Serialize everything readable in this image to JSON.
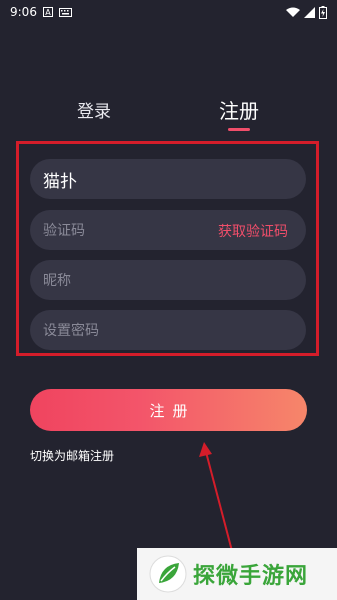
{
  "status_bar": {
    "time": "9:06",
    "left_icons": [
      "a-notification-icon",
      "keyboard-icon"
    ],
    "right_icons": [
      "wifi-icon",
      "signal-icon",
      "battery-icon"
    ]
  },
  "tabs": [
    {
      "label": "登录",
      "selected": false
    },
    {
      "label": "注册",
      "selected": true
    }
  ],
  "form": {
    "phone_value": "猫扑",
    "code_placeholder": "验证码",
    "get_code_label": "获取验证码",
    "nickname_placeholder": "昵称",
    "password_placeholder": "设置密码"
  },
  "register_button_label": "注册",
  "switch_link_label": "切换为邮箱注册",
  "watermark": {
    "text": "探微手游网"
  },
  "colors": {
    "background": "#23232f",
    "field": "#363645",
    "accent": "#f04e6a",
    "button_gradient_start": "#f0445f",
    "button_gradient_end": "#f6866a",
    "annotation_red": "#d41d2a"
  }
}
